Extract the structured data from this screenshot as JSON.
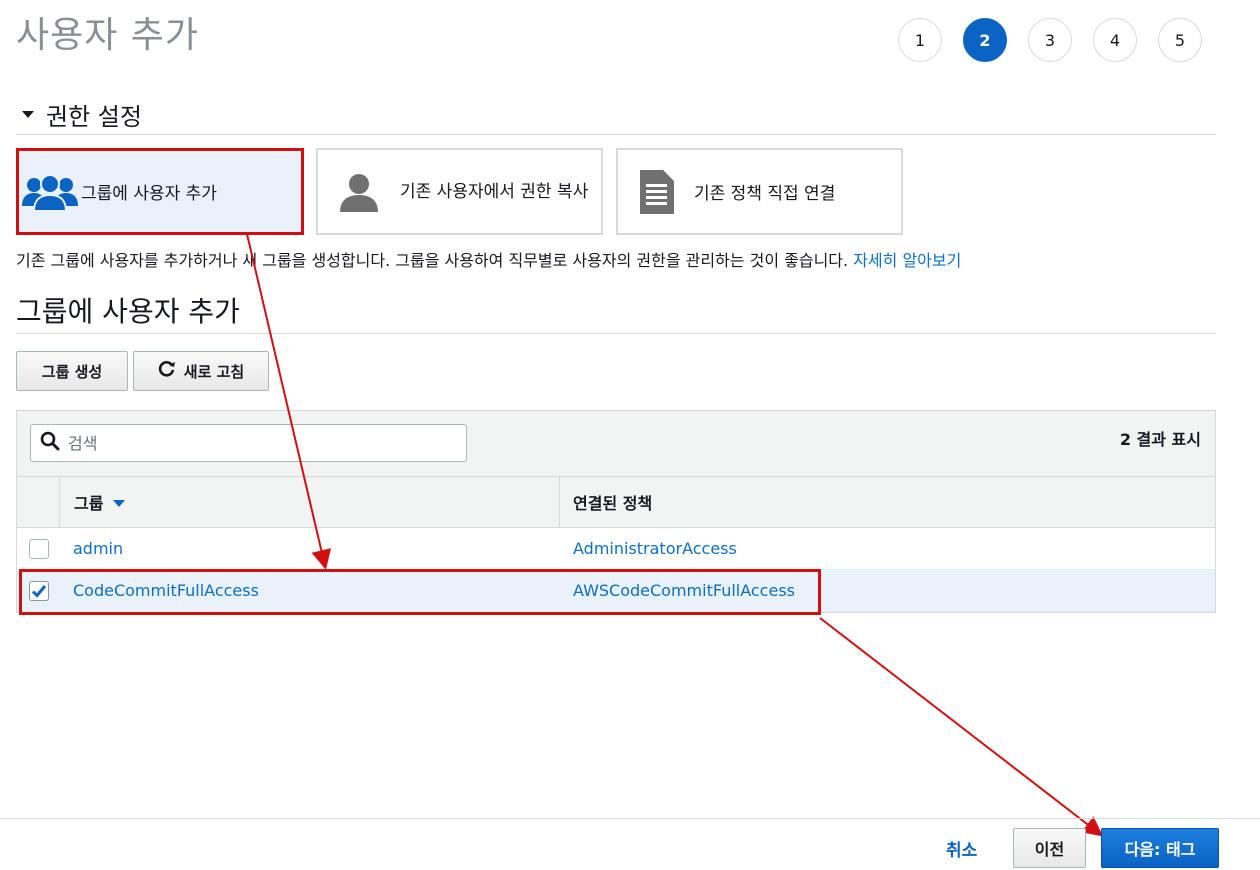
{
  "page": {
    "title": "사용자 추가"
  },
  "steps": [
    "1",
    "2",
    "3",
    "4",
    "5"
  ],
  "active_step": 2,
  "permissions": {
    "heading": "권한 설정",
    "options": [
      {
        "label": "그룹에 사용자 추가",
        "icon": "users-group-icon",
        "selected": true
      },
      {
        "label": "기존 사용자에서 권한 복사",
        "icon": "user-icon",
        "selected": false
      },
      {
        "label": "기존 정책 직접 연결",
        "icon": "document-icon",
        "selected": false
      }
    ],
    "description": "기존 그룹에 사용자를 추가하거나 새 그룹을 생성합니다. 그룹을 사용하여 직무별로 사용자의 권한을 관리하는 것이 좋습니다.",
    "learn_more": "자세히 알아보기"
  },
  "group_section": {
    "heading": "그룹에 사용자 추가",
    "create_button": "그룹 생성",
    "refresh_button": "새로 고침",
    "search_placeholder": "검색",
    "result_count": "2 결과 표시",
    "columns": [
      "그룹",
      "연결된 정책"
    ],
    "rows": [
      {
        "group": "admin",
        "policy": "AdministratorAccess",
        "checked": false
      },
      {
        "group": "CodeCommitFullAccess",
        "policy": "AWSCodeCommitFullAccess",
        "checked": true
      }
    ]
  },
  "footer": {
    "cancel": "취소",
    "previous": "이전",
    "next": "다음: 태그"
  },
  "colors": {
    "accent": "#0b63c4",
    "link": "#0b6fc5",
    "annotation": "#d20f10",
    "selected_bg": "#e9f1fb"
  }
}
